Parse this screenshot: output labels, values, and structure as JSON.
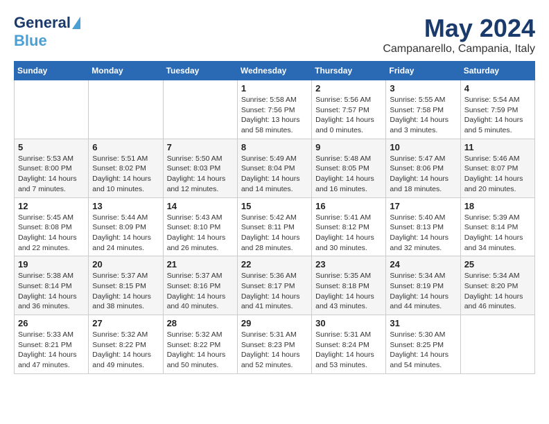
{
  "logo": {
    "text_general": "General",
    "text_blue": "Blue"
  },
  "title": "May 2024",
  "subtitle": "Campanarello, Campania, Italy",
  "days_of_week": [
    "Sunday",
    "Monday",
    "Tuesday",
    "Wednesday",
    "Thursday",
    "Friday",
    "Saturday"
  ],
  "weeks": [
    [
      {
        "day": "",
        "info": ""
      },
      {
        "day": "",
        "info": ""
      },
      {
        "day": "",
        "info": ""
      },
      {
        "day": "1",
        "info": "Sunrise: 5:58 AM\nSunset: 7:56 PM\nDaylight: 13 hours\nand 58 minutes."
      },
      {
        "day": "2",
        "info": "Sunrise: 5:56 AM\nSunset: 7:57 PM\nDaylight: 14 hours\nand 0 minutes."
      },
      {
        "day": "3",
        "info": "Sunrise: 5:55 AM\nSunset: 7:58 PM\nDaylight: 14 hours\nand 3 minutes."
      },
      {
        "day": "4",
        "info": "Sunrise: 5:54 AM\nSunset: 7:59 PM\nDaylight: 14 hours\nand 5 minutes."
      }
    ],
    [
      {
        "day": "5",
        "info": "Sunrise: 5:53 AM\nSunset: 8:00 PM\nDaylight: 14 hours\nand 7 minutes."
      },
      {
        "day": "6",
        "info": "Sunrise: 5:51 AM\nSunset: 8:02 PM\nDaylight: 14 hours\nand 10 minutes."
      },
      {
        "day": "7",
        "info": "Sunrise: 5:50 AM\nSunset: 8:03 PM\nDaylight: 14 hours\nand 12 minutes."
      },
      {
        "day": "8",
        "info": "Sunrise: 5:49 AM\nSunset: 8:04 PM\nDaylight: 14 hours\nand 14 minutes."
      },
      {
        "day": "9",
        "info": "Sunrise: 5:48 AM\nSunset: 8:05 PM\nDaylight: 14 hours\nand 16 minutes."
      },
      {
        "day": "10",
        "info": "Sunrise: 5:47 AM\nSunset: 8:06 PM\nDaylight: 14 hours\nand 18 minutes."
      },
      {
        "day": "11",
        "info": "Sunrise: 5:46 AM\nSunset: 8:07 PM\nDaylight: 14 hours\nand 20 minutes."
      }
    ],
    [
      {
        "day": "12",
        "info": "Sunrise: 5:45 AM\nSunset: 8:08 PM\nDaylight: 14 hours\nand 22 minutes."
      },
      {
        "day": "13",
        "info": "Sunrise: 5:44 AM\nSunset: 8:09 PM\nDaylight: 14 hours\nand 24 minutes."
      },
      {
        "day": "14",
        "info": "Sunrise: 5:43 AM\nSunset: 8:10 PM\nDaylight: 14 hours\nand 26 minutes."
      },
      {
        "day": "15",
        "info": "Sunrise: 5:42 AM\nSunset: 8:11 PM\nDaylight: 14 hours\nand 28 minutes."
      },
      {
        "day": "16",
        "info": "Sunrise: 5:41 AM\nSunset: 8:12 PM\nDaylight: 14 hours\nand 30 minutes."
      },
      {
        "day": "17",
        "info": "Sunrise: 5:40 AM\nSunset: 8:13 PM\nDaylight: 14 hours\nand 32 minutes."
      },
      {
        "day": "18",
        "info": "Sunrise: 5:39 AM\nSunset: 8:14 PM\nDaylight: 14 hours\nand 34 minutes."
      }
    ],
    [
      {
        "day": "19",
        "info": "Sunrise: 5:38 AM\nSunset: 8:14 PM\nDaylight: 14 hours\nand 36 minutes."
      },
      {
        "day": "20",
        "info": "Sunrise: 5:37 AM\nSunset: 8:15 PM\nDaylight: 14 hours\nand 38 minutes."
      },
      {
        "day": "21",
        "info": "Sunrise: 5:37 AM\nSunset: 8:16 PM\nDaylight: 14 hours\nand 40 minutes."
      },
      {
        "day": "22",
        "info": "Sunrise: 5:36 AM\nSunset: 8:17 PM\nDaylight: 14 hours\nand 41 minutes."
      },
      {
        "day": "23",
        "info": "Sunrise: 5:35 AM\nSunset: 8:18 PM\nDaylight: 14 hours\nand 43 minutes."
      },
      {
        "day": "24",
        "info": "Sunrise: 5:34 AM\nSunset: 8:19 PM\nDaylight: 14 hours\nand 44 minutes."
      },
      {
        "day": "25",
        "info": "Sunrise: 5:34 AM\nSunset: 8:20 PM\nDaylight: 14 hours\nand 46 minutes."
      }
    ],
    [
      {
        "day": "26",
        "info": "Sunrise: 5:33 AM\nSunset: 8:21 PM\nDaylight: 14 hours\nand 47 minutes."
      },
      {
        "day": "27",
        "info": "Sunrise: 5:32 AM\nSunset: 8:22 PM\nDaylight: 14 hours\nand 49 minutes."
      },
      {
        "day": "28",
        "info": "Sunrise: 5:32 AM\nSunset: 8:22 PM\nDaylight: 14 hours\nand 50 minutes."
      },
      {
        "day": "29",
        "info": "Sunrise: 5:31 AM\nSunset: 8:23 PM\nDaylight: 14 hours\nand 52 minutes."
      },
      {
        "day": "30",
        "info": "Sunrise: 5:31 AM\nSunset: 8:24 PM\nDaylight: 14 hours\nand 53 minutes."
      },
      {
        "day": "31",
        "info": "Sunrise: 5:30 AM\nSunset: 8:25 PM\nDaylight: 14 hours\nand 54 minutes."
      },
      {
        "day": "",
        "info": ""
      }
    ]
  ]
}
